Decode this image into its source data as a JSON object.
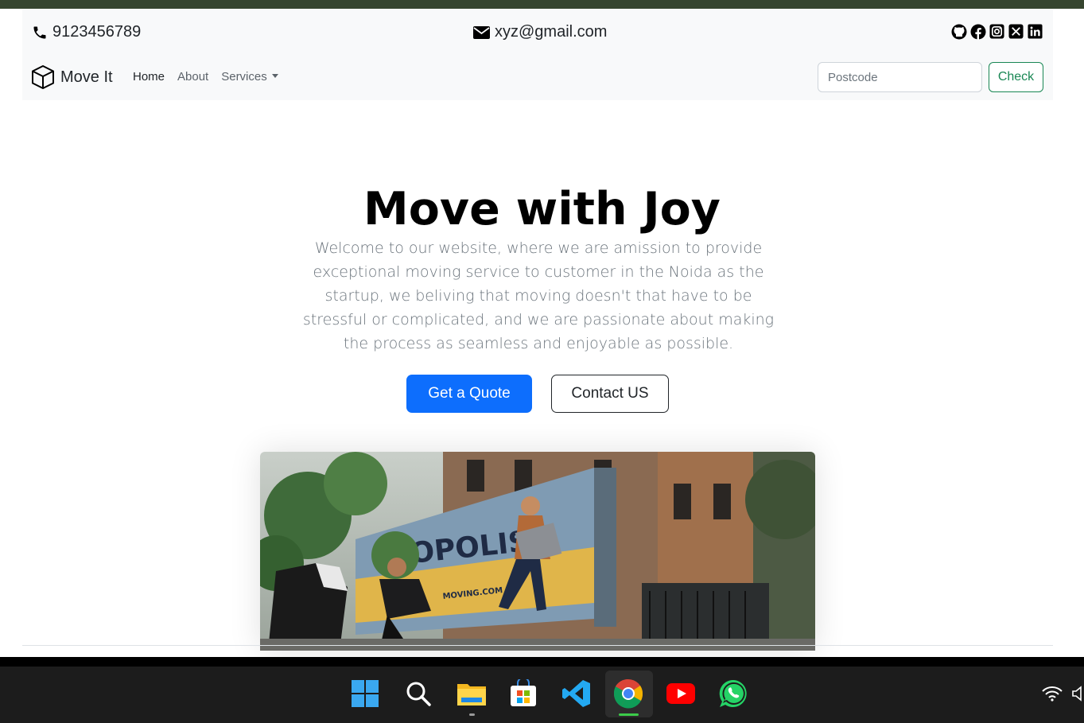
{
  "contact": {
    "phone": "9123456789",
    "email": "xyz@gmail.com"
  },
  "social_icons": [
    "github-icon",
    "facebook-icon",
    "instagram-icon",
    "x-icon",
    "linkedin-icon"
  ],
  "nav": {
    "brand": "Move It",
    "links": [
      {
        "label": "Home",
        "active": true
      },
      {
        "label": "About"
      },
      {
        "label": "Services",
        "dropdown": true
      }
    ],
    "postcode_placeholder": "Postcode",
    "check_label": "Check"
  },
  "hero": {
    "title": "Move with Joy",
    "text": "Welcome to our website, where we are amission to provide exceptional moving service to customer in the Noida as the startup, we beliving that moving doesn't that have to be stressful or complicated, and we are passionate about making the process as seamless and enjoyable as possible.",
    "primary_button": "Get a Quote",
    "secondary_button": "Contact US",
    "photo_truck_text": "OPOLIS",
    "photo_truck_small": "MOVING.COM"
  },
  "taskbar": {
    "apps": [
      "windows-start-icon",
      "search-icon",
      "file-explorer-icon",
      "store-icon",
      "vscode-icon",
      "chrome-icon",
      "youtube-icon",
      "whatsapp-icon"
    ],
    "active": "chrome-icon"
  },
  "colors": {
    "primary": "#0d6efd",
    "success": "#198754",
    "dark": "#212529",
    "muted": "#6c757d"
  }
}
